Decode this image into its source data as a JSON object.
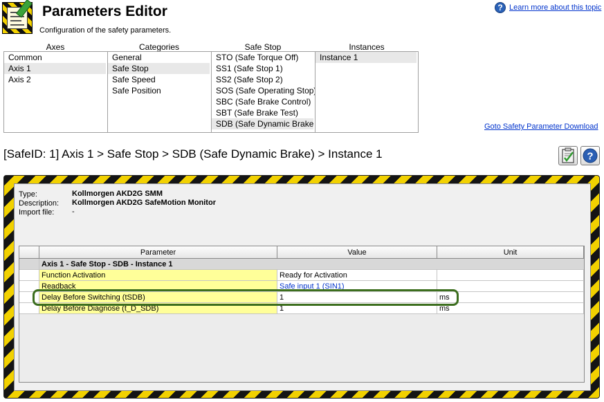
{
  "header": {
    "title": "Parameters Editor",
    "subtitle": "Configuration of the safety parameters.",
    "help_link": "Learn more about this topic"
  },
  "columns": {
    "axes": {
      "label": "Axes",
      "items": [
        "Common",
        "Axis 1",
        "Axis 2"
      ],
      "selected": "Axis 1"
    },
    "categories": {
      "label": "Categories",
      "items": [
        "General",
        "Safe Stop",
        "Safe Speed",
        "Safe Position"
      ],
      "selected": "Safe Stop"
    },
    "safe_stop": {
      "label": "Safe Stop",
      "items": [
        "STO (Safe Torque Off)",
        "SS1 (Safe Stop 1)",
        "SS2 (Safe Stop 2)",
        "SOS (Safe Operating Stop)",
        "SBC (Safe Brake Control)",
        "SBT (Safe Brake Test)",
        "SDB (Safe Dynamic Brake)"
      ],
      "selected": "SDB (Safe Dynamic Brake)"
    },
    "instances": {
      "label": "Instances",
      "items": [
        "Instance 1"
      ],
      "selected": "Instance 1"
    }
  },
  "download_link": "Goto Safety Parameter Download",
  "breadcrumb": "[SafeID: 1]  Axis 1 > Safe Stop > SDB (Safe Dynamic Brake) > Instance 1",
  "device_info": {
    "type_label": "Type:",
    "type_value": "Kollmorgen AKD2G SMM",
    "description_label": "Description:",
    "description_value": "Kollmorgen AKD2G SafeMotion Monitor",
    "import_label": "Import file:",
    "import_value": "-"
  },
  "table": {
    "headers": [
      "Parameter",
      "Value",
      "Unit"
    ],
    "group": "Axis 1 - Safe Stop - SDB - Instance 1",
    "rows": [
      {
        "parameter": "Function Activation",
        "value": "Ready for Activation",
        "unit": ""
      },
      {
        "parameter": "Readback",
        "value": "Safe input 1 (SIN1)",
        "unit": ""
      },
      {
        "parameter": "Delay Before Switching (tSDB)",
        "value": "1",
        "unit": "ms"
      },
      {
        "parameter": "Delay Before Diagnose (t_D_SDB)",
        "value": "1",
        "unit": "ms"
      }
    ]
  },
  "colors": {
    "hazard_yellow": "#f2d100",
    "hazard_black": "#141414",
    "param_highlight": "#ffff99",
    "link_blue": "#0033cc",
    "selection_outline": "#3c6e1e"
  }
}
